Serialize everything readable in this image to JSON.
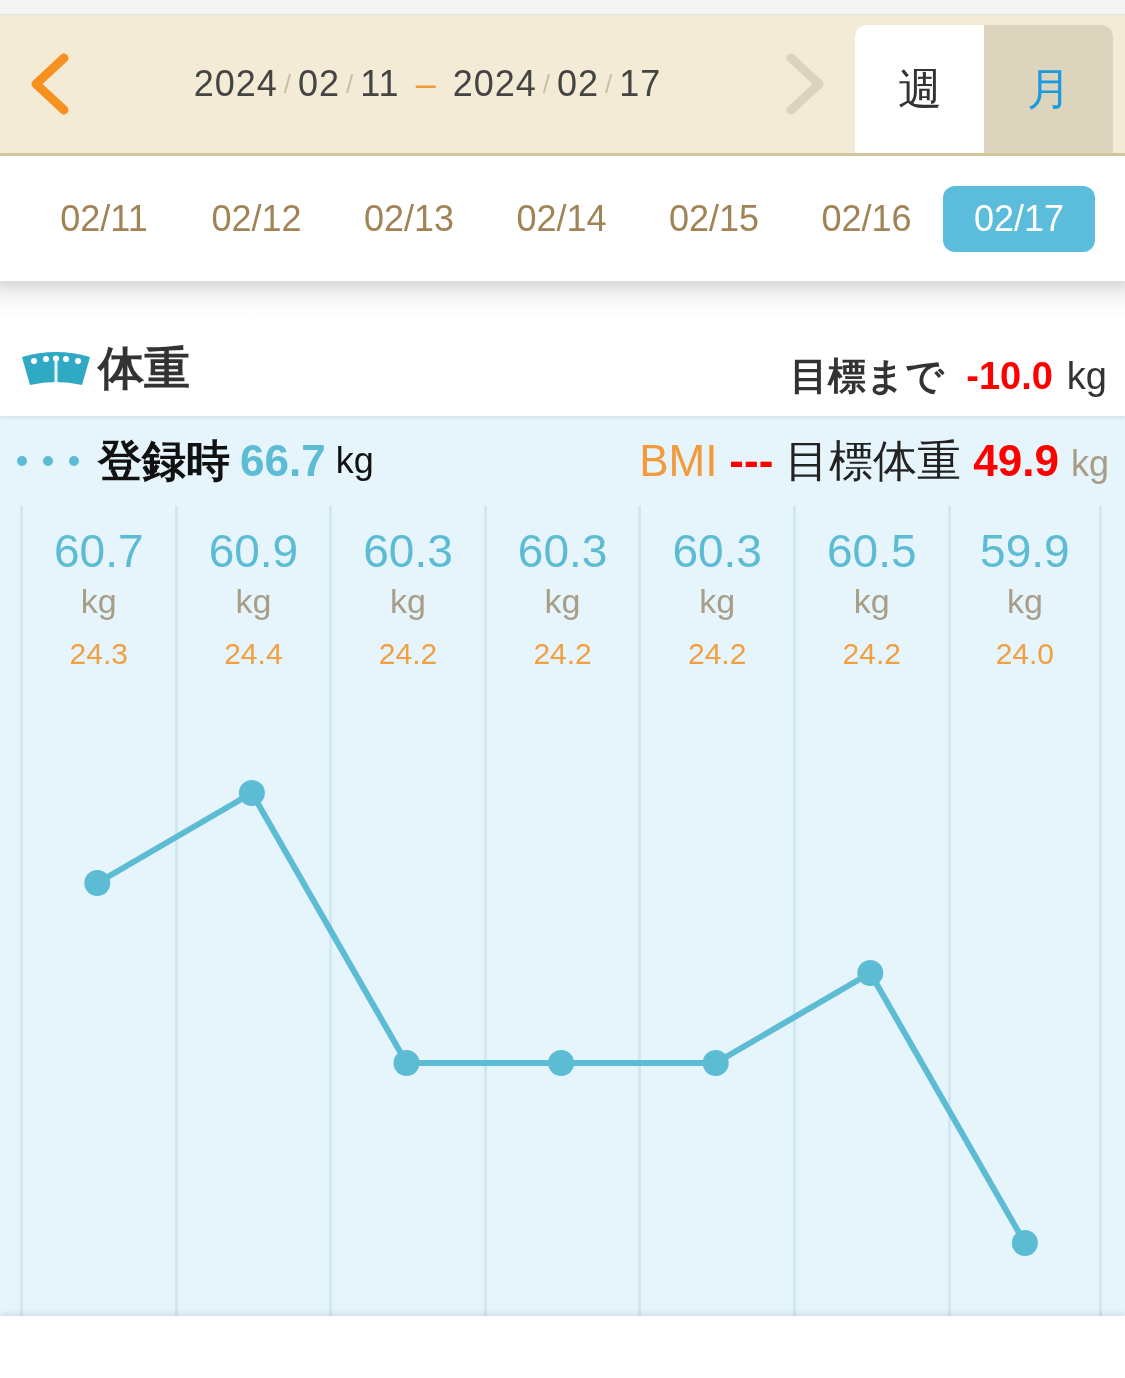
{
  "range": {
    "prev": {
      "disabled": false
    },
    "start": [
      "2024",
      "/",
      "02",
      "/",
      "11"
    ],
    "separator": "–",
    "end": [
      "2024",
      "/",
      "02",
      "/",
      "17"
    ],
    "next": {
      "disabled": true
    }
  },
  "tabs": [
    {
      "label": "週",
      "selected": true
    },
    {
      "label": "月",
      "selected": false
    }
  ],
  "days": [
    {
      "label": "02/11",
      "selected": false
    },
    {
      "label": "02/12",
      "selected": false
    },
    {
      "label": "02/13",
      "selected": false
    },
    {
      "label": "02/14",
      "selected": false
    },
    {
      "label": "02/15",
      "selected": false
    },
    {
      "label": "02/16",
      "selected": false
    },
    {
      "label": "02/17",
      "selected": true
    }
  ],
  "section": {
    "title": "体重",
    "goal_label": "目標まで",
    "goal_value": "-10.0",
    "goal_unit": "kg"
  },
  "summary": {
    "initial_label": "登録時",
    "initial_value": "66.7",
    "initial_unit": "kg",
    "bmi_label": "BMI",
    "bmi_value": "---",
    "target_label": "目標体重",
    "target_value": "49.9",
    "target_unit": "kg"
  },
  "columns": [
    {
      "unit": "kg",
      "bmi": "24.3"
    },
    {
      "unit": "kg",
      "bmi": "24.4"
    },
    {
      "unit": "kg",
      "bmi": "24.2"
    },
    {
      "unit": "kg",
      "bmi": "24.2"
    },
    {
      "unit": "kg",
      "bmi": "24.2"
    },
    {
      "unit": "kg",
      "bmi": "24.2"
    },
    {
      "unit": "kg",
      "bmi": "24.0"
    }
  ],
  "chart_data": {
    "type": "line",
    "data_labels": true,
    "series": [
      {
        "color": "#5bbcd4",
        "marker": "circle",
        "values": [
          60.7,
          60.9,
          60.3,
          60.3,
          60.3,
          60.5,
          59.9
        ]
      }
    ]
  }
}
